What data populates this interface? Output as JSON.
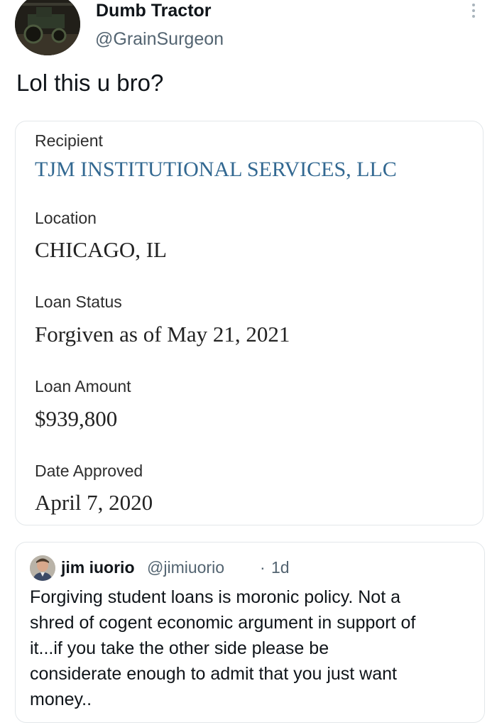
{
  "author": {
    "display_name": "Dumb Tractor",
    "handle": "@GrainSurgeon",
    "avatar_icon": "tractor-photo-avatar"
  },
  "tweet": {
    "text": "Lol this u bro?"
  },
  "loan_card": {
    "fields": [
      {
        "label": "Recipient",
        "value": "TJM INSTITUTIONAL SERVICES, LLC"
      },
      {
        "label": "Location",
        "value": "CHICAGO, IL"
      },
      {
        "label": "Loan Status",
        "value": "Forgiven as of May 21, 2021"
      },
      {
        "label": "Loan Amount",
        "value": "$939,800"
      },
      {
        "label": "Date Approved",
        "value": "April 7, 2020"
      }
    ],
    "link_color": "#326891"
  },
  "quoted_tweet": {
    "display_name": "jim iuorio",
    "handle": "@jimiuorio",
    "separator": "·",
    "age": "1d",
    "avatar_icon": "person-photo-avatar",
    "lines": [
      "Forgiving student loans is moronic policy.  Not a",
      "shred of cogent economic argument in support of",
      "it...if you take the other side please be",
      "considerate enough to admit that you just want",
      "money.."
    ]
  },
  "colors": {
    "text": "#0f1419",
    "secondary": "#536471",
    "border": "#e3e7ea"
  }
}
